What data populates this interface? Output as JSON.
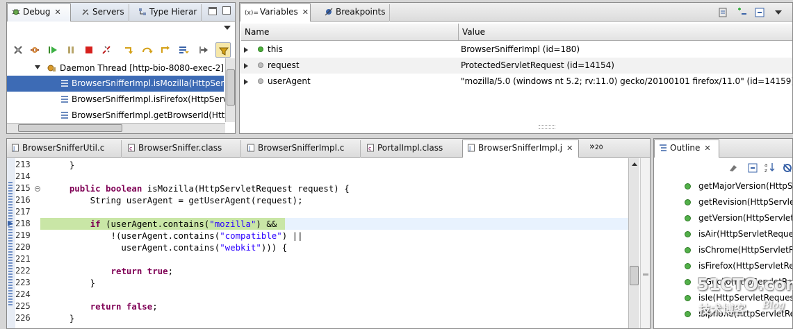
{
  "debug_view": {
    "tabs": [
      {
        "label": "Debug"
      },
      {
        "label": "Servers"
      },
      {
        "label": "Type Hierar"
      }
    ],
    "tree": [
      {
        "label": "Daemon Thread [http-bio-8080-exec-2] (S"
      },
      {
        "label": "BrowserSnifferImpl.isMozilla(HttpServ"
      },
      {
        "label": "BrowserSnifferImpl.isFirefox(HttpServ"
      },
      {
        "label": "BrowserSnifferImpl.getBrowserId(Http"
      }
    ]
  },
  "variables_view": {
    "tabs": [
      {
        "label": "Variables"
      },
      {
        "label": "Breakpoints"
      }
    ],
    "tab_prefix": "(x)=",
    "columns": {
      "name": "Name",
      "value": "Value"
    },
    "rows": [
      {
        "name": "this",
        "value": "BrowserSnifferImpl  (id=180)"
      },
      {
        "name": "request",
        "value": "ProtectedServletRequest  (id=14154)"
      },
      {
        "name": "userAgent",
        "value": "\"mozilla/5.0 (windows nt 5.2; rv:11.0) gecko/20100101 firefox/11.0\" (id=14159)"
      }
    ]
  },
  "editor": {
    "tabs": [
      {
        "label": "BrowserSnifferUtil.c"
      },
      {
        "label": "BrowserSniffer.class"
      },
      {
        "label": "BrowserSnifferImpl.c"
      },
      {
        "label": "PortalImpl.class"
      },
      {
        "label": "BrowserSnifferImpl.j"
      }
    ],
    "overflow_label": "»",
    "overflow_count": "20",
    "lines": [
      {
        "num": "213",
        "text": "    }"
      },
      {
        "num": "214",
        "text": ""
      },
      {
        "num": "215",
        "text": "    public boolean isMozilla(HttpServletRequest request) {"
      },
      {
        "num": "216",
        "text": "        String userAgent = getUserAgent(request);"
      },
      {
        "num": "217",
        "text": ""
      },
      {
        "num": "218",
        "text": "        if (userAgent.contains(\"mozilla\") &&"
      },
      {
        "num": "219",
        "text": "            !(userAgent.contains(\"compatible\") ||"
      },
      {
        "num": "220",
        "text": "              userAgent.contains(\"webkit\"))) {"
      },
      {
        "num": "221",
        "text": ""
      },
      {
        "num": "222",
        "text": "            return true;"
      },
      {
        "num": "223",
        "text": "        }"
      },
      {
        "num": "224",
        "text": ""
      },
      {
        "num": "225",
        "text": "        return false;"
      },
      {
        "num": "226",
        "text": "    }"
      }
    ]
  },
  "outline_view": {
    "tab": {
      "label": "Outline"
    },
    "items": [
      {
        "label": "getMajorVersion(HttpSe"
      },
      {
        "label": "getRevision(HttpServletRe"
      },
      {
        "label": "getVersion(HttpServletR"
      },
      {
        "label": "isAir(HttpServletReque"
      },
      {
        "label": "isChrome(HttpServletR"
      },
      {
        "label": "isFirefox(HttpServletRe"
      },
      {
        "label": "isGecko(HttpServletRe"
      },
      {
        "label": "isIe(HttpServletReques"
      },
      {
        "label": "isIphone(HttpServletRe"
      }
    ]
  },
  "watermark": {
    "line1": "51CTO.com",
    "line2": "技术博客",
    "line3": "Blog"
  },
  "colors": {
    "selection": "#3d6bb5",
    "current_line": "#e8f2fe",
    "debug_line": "#c9e6a6",
    "keyword": "#7f0055",
    "string": "#2a00ff"
  }
}
